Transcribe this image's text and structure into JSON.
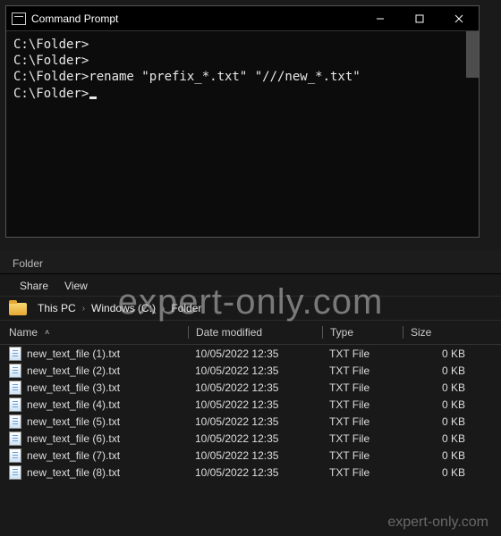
{
  "cmd": {
    "title": "Command Prompt",
    "lines": [
      "C:\\Folder>",
      "C:\\Folder>",
      "C:\\Folder>rename \"prefix_*.txt\" \"///new_*.txt\"",
      "",
      "C:\\Folder>"
    ]
  },
  "explorer": {
    "window_title": "Folder",
    "tabs": {
      "share": "Share",
      "view": "View"
    },
    "breadcrumb": [
      "This PC",
      "Windows  (C:)",
      "Folder"
    ],
    "columns": {
      "name": "Name",
      "date": "Date modified",
      "type": "Type",
      "size": "Size"
    },
    "rows": [
      {
        "name": "new_text_file (1).txt",
        "date": "10/05/2022 12:35",
        "type": "TXT File",
        "size": "0 KB"
      },
      {
        "name": "new_text_file (2).txt",
        "date": "10/05/2022 12:35",
        "type": "TXT File",
        "size": "0 KB"
      },
      {
        "name": "new_text_file (3).txt",
        "date": "10/05/2022 12:35",
        "type": "TXT File",
        "size": "0 KB"
      },
      {
        "name": "new_text_file (4).txt",
        "date": "10/05/2022 12:35",
        "type": "TXT File",
        "size": "0 KB"
      },
      {
        "name": "new_text_file (5).txt",
        "date": "10/05/2022 12:35",
        "type": "TXT File",
        "size": "0 KB"
      },
      {
        "name": "new_text_file (6).txt",
        "date": "10/05/2022 12:35",
        "type": "TXT File",
        "size": "0 KB"
      },
      {
        "name": "new_text_file (7).txt",
        "date": "10/05/2022 12:35",
        "type": "TXT File",
        "size": "0 KB"
      },
      {
        "name": "new_text_file (8).txt",
        "date": "10/05/2022 12:35",
        "type": "TXT File",
        "size": "0 KB"
      }
    ]
  },
  "watermark": {
    "big": "expert-only.com",
    "small": "expert-only.com"
  }
}
